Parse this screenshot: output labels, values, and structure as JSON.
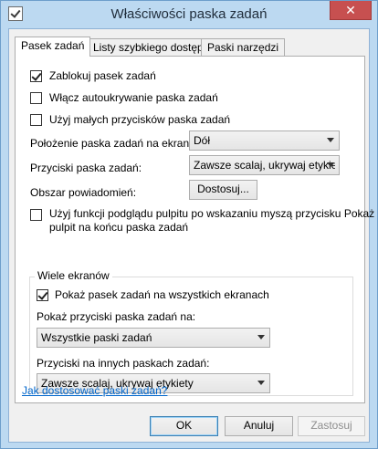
{
  "window": {
    "title": "Właściwości paska zadań",
    "close_label": "✕"
  },
  "tabs": [
    {
      "label": "Pasek zadań"
    },
    {
      "label": "Listy szybkiego dostępu"
    },
    {
      "label": "Paski narzędzi"
    }
  ],
  "taskbar": {
    "lock_label": "Zablokuj pasek zadań",
    "autohide_label": "Włącz autoukrywanie paska zadań",
    "small_buttons_label": "Użyj małych przycisków paska zadań",
    "location_label": "Położenie paska zadań na ekranie:",
    "location_value": "Dół",
    "buttons_label": "Przyciski paska zadań:",
    "buttons_value": "Zawsze scalaj, ukrywaj etykiety",
    "notification_label": "Obszar powiadomień:",
    "customize_button": "Dostosuj...",
    "peek_label_line1": "Użyj funkcji podglądu pulpitu po wskazaniu myszą przycisku Pokaż",
    "peek_label_line2": "pulpit na końcu paska zadań"
  },
  "multi_display": {
    "group_title": "Wiele ekranów",
    "show_all_label": "Pokaż pasek zadań na wszystkich ekranach",
    "show_buttons_on_label": "Pokaż przyciski paska zadań na:",
    "show_buttons_on_value": "Wszystkie paski zadań",
    "other_buttons_label": "Przyciski na innych paskach zadań:",
    "other_buttons_value": "Zawsze scalaj, ukrywaj etykiety"
  },
  "help_link": "Jak dostosować paski zadań?",
  "buttons": {
    "ok": "OK",
    "cancel": "Anuluj",
    "apply": "Zastosuj"
  }
}
